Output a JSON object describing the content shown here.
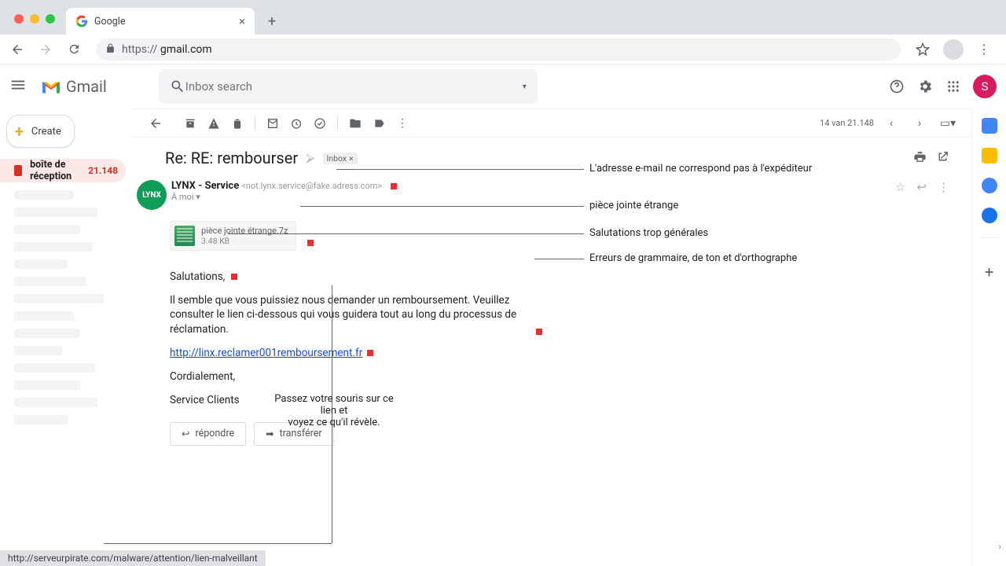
{
  "browser": {
    "tab_title": "Google",
    "url_display_prefix": "https:// ",
    "url_display_host": "gmail.com"
  },
  "header": {
    "product": "Gmail",
    "search_placeholder": "Inbox search",
    "user_initial": "S"
  },
  "sidebar": {
    "create": "Create",
    "inbox_label": "boîte de réception",
    "inbox_count": "21.148"
  },
  "toolbar": {
    "counter": "14 van 21.148"
  },
  "email": {
    "subject": "Re: RE: rembourser",
    "label": "Inbox",
    "sender_name": "LYNX -  Service",
    "sender_addr": "<not.lynx.service@fake.adress.com>",
    "to_line": "À moi",
    "attachment_name": "pièce jointe étrange.7z",
    "attachment_size": "3.48 KB",
    "salutation": "Salutations,",
    "para1": "Il semble que vous puissiez nous demander un remboursement. Veuillez consulter le lien ci-dessous qui vous guidera tout au long du processus de réclamation.",
    "link": "http://linx.reclamer001remboursement.fr",
    "signoff1": "Cordialement,",
    "signoff2": "Service Clients",
    "reply": "répondre",
    "forward": "transférer",
    "avatar_text": "LYNX"
  },
  "annotations": {
    "a1": "L'adresse e-mail ne correspond pas à l'expéditeur",
    "a2": "pièce jointe étrange",
    "a3": "Salutations trop générales",
    "a4": "Erreurs de grammaire, de ton et d'orthographe",
    "hover_line1": "Passez votre souris sur ce lien et",
    "hover_line2": "voyez ce qu'il révèle."
  },
  "statusbar": "http://serveurpirate.com/malware/attention/lien-malveillant"
}
